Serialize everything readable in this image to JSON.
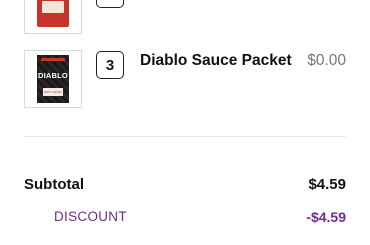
{
  "cart": {
    "items": [
      {
        "name": "",
        "quantity": "",
        "price": "",
        "packet_color": "#c8322d"
      },
      {
        "name": "Diablo Sauce Packet",
        "quantity": "3",
        "price": "$0.00",
        "packet_color": "#1c1a1a",
        "packet_text": "DIABLO",
        "packet_subtext": "NEXT LEVEL"
      }
    ]
  },
  "summary": {
    "subtotal_label": "Subtotal",
    "subtotal_value": "$4.59",
    "discount_label": "DISCOUNT",
    "discount_value": "-$4.59",
    "accent_color": "#6b2c91"
  }
}
